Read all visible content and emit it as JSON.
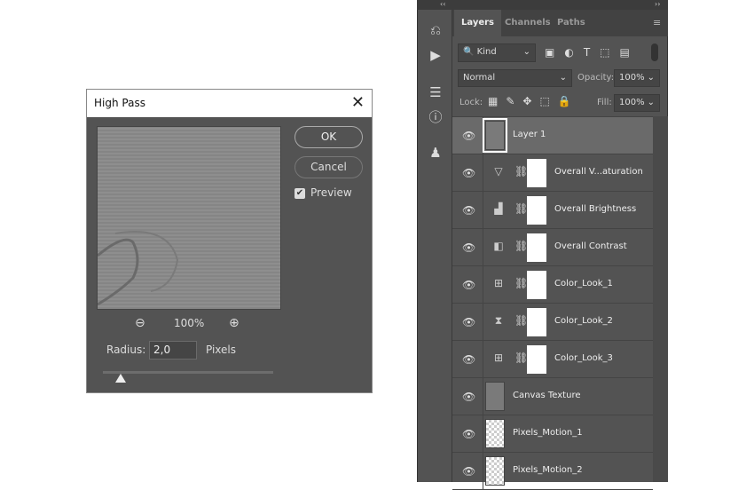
{
  "dialog": {
    "title": "High Pass",
    "ok": "OK",
    "cancel": "Cancel",
    "preview_label": "Preview",
    "preview_checked": true,
    "zoom": "100%",
    "radius_label": "Radius:",
    "radius_value": "2,0",
    "units": "Pixels"
  },
  "panel": {
    "collapse_left": "‹‹",
    "collapse_right": "››",
    "tabs": [
      "Layers",
      "Channels",
      "Paths"
    ],
    "filter_kind": "Kind",
    "blend_mode": "Normal",
    "opacity_label": "Opacity:",
    "opacity_value": "100%",
    "lock_label": "Lock:",
    "fill_label": "Fill:",
    "fill_value": "100%"
  },
  "layers": [
    {
      "name": "Layer 1",
      "type": "pixel",
      "selected": true
    },
    {
      "name": "Overall V...aturation",
      "type": "adjust",
      "icon": "vibrance-icon"
    },
    {
      "name": "Overall Brightness",
      "type": "adjust",
      "icon": "levels-icon"
    },
    {
      "name": "Overall Contrast",
      "type": "adjust",
      "icon": "gradient-map-icon"
    },
    {
      "name": "Color_Look_1",
      "type": "adjust",
      "icon": "curves-icon"
    },
    {
      "name": "Color_Look_2",
      "type": "adjust",
      "icon": "exposure-icon"
    },
    {
      "name": "Color_Look_3",
      "type": "adjust",
      "icon": "curves-icon"
    },
    {
      "name": "Canvas Texture",
      "type": "pixel"
    },
    {
      "name": "Pixels_Motion_1",
      "type": "transparent"
    },
    {
      "name": "Pixels_Motion_2",
      "type": "transparent"
    }
  ]
}
